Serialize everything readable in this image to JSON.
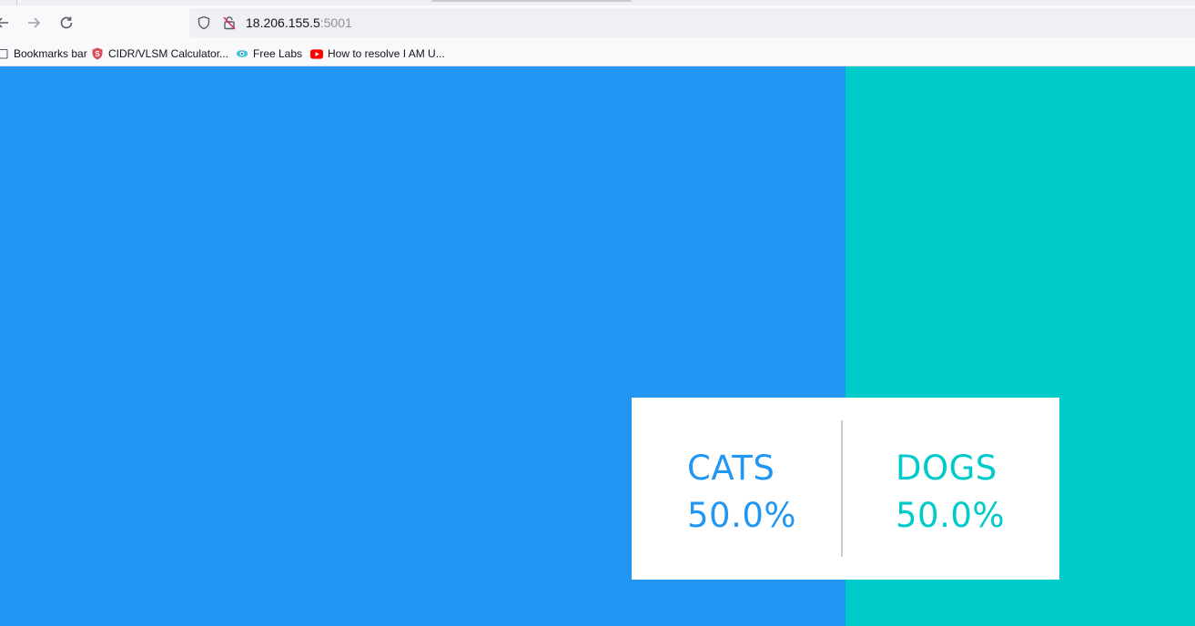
{
  "browser": {
    "url_host": "18.206.155.5",
    "url_port": ":5001",
    "icons": [
      "back-icon",
      "forward-icon",
      "reload-icon",
      "tracking-shield-icon",
      "insecure-lock-icon"
    ]
  },
  "bookmarks": [
    {
      "label": "Bookmarks bar",
      "icon": "folder-icon"
    },
    {
      "label": "CIDR/VLSM Calculator...",
      "icon": "shield-s-icon"
    },
    {
      "label": "Free Labs",
      "icon": "eye-icon"
    },
    {
      "label": "How to resolve I AM U...",
      "icon": "youtube-icon"
    }
  ],
  "vote_results": {
    "colors": {
      "cats": "#2196f3",
      "dogs": "#00cbca"
    },
    "share": {
      "cats": 0.5,
      "dogs": 0.5
    },
    "cats": {
      "label": "CATS",
      "percent": "50.0%"
    },
    "dogs": {
      "label": "DOGS",
      "percent": "50.0%"
    }
  }
}
